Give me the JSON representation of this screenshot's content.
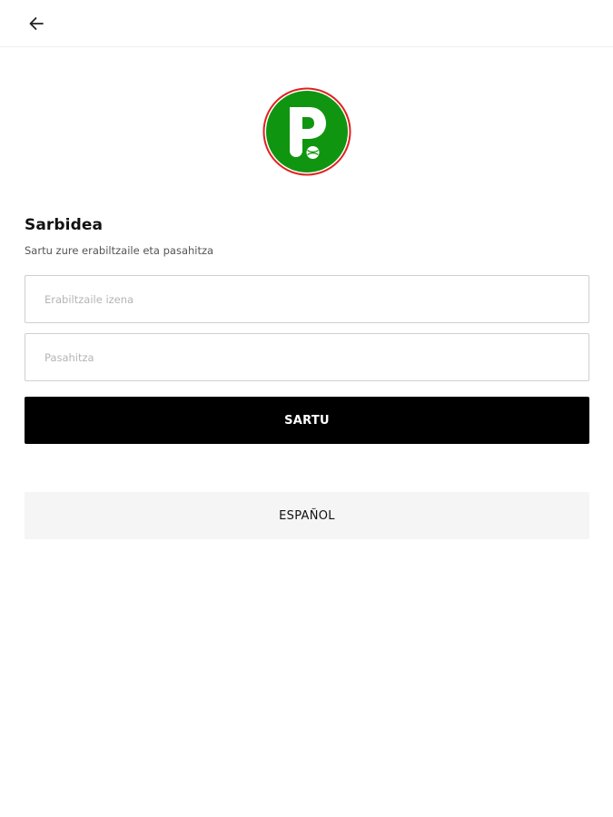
{
  "header": {
    "back_icon": "arrow-left-icon"
  },
  "logo": {
    "letter": "P",
    "ring_color": "#e02020",
    "fill_color": "#109510",
    "ball_icon": "ball-icon"
  },
  "login": {
    "title": "Sarbidea",
    "subtitle": "Sartu zure erabiltzaile eta pasahitza",
    "username_placeholder": "Erabiltzaile izena",
    "password_placeholder": "Pasahitza",
    "submit_label": "SARTU",
    "language_label": "ESPAÑOL"
  },
  "colors": {
    "primary_button": "#000000",
    "secondary_button": "#f5f5f5"
  }
}
